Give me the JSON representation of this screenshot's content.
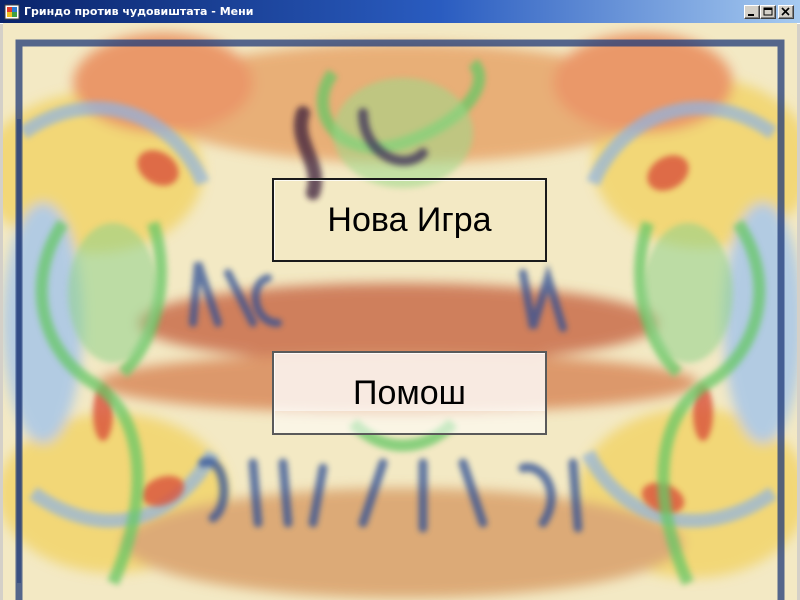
{
  "window": {
    "title": "Гриндо против чудовиштата - Мени",
    "controls": [
      "minimize",
      "maximize",
      "close"
    ]
  },
  "menu": {
    "new_game_label": "Нова Игра",
    "help_label": "Помош"
  },
  "colors": {
    "titlebar_start": "#0a246a",
    "titlebar_end": "#a6caf0",
    "frame_border": "#1f3a78",
    "background_yellow": "#f3e9c4",
    "accent_red": "#d9513a",
    "accent_green": "#66c766"
  }
}
